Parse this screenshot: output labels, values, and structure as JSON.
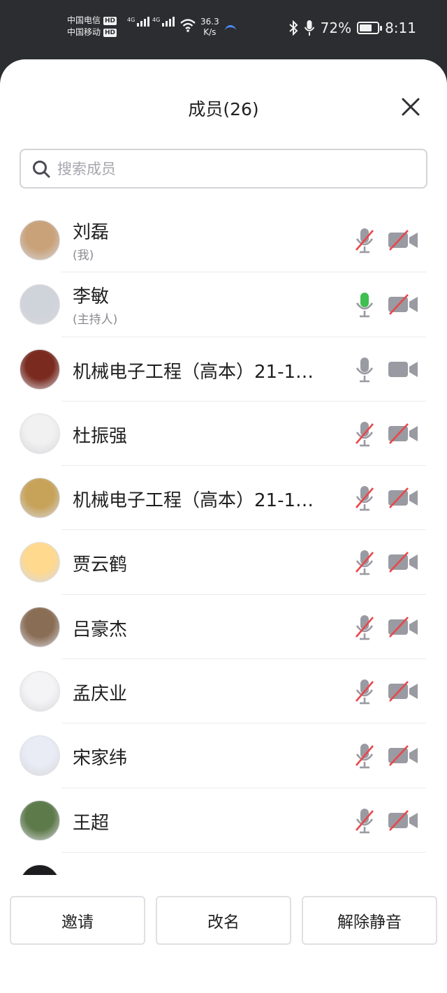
{
  "status_bar": {
    "carrier_1": "中国电信",
    "carrier_2": "中国移动",
    "hd_badge": "HD",
    "network_1": "4G",
    "network_2": "4G",
    "speed_value": "36.3",
    "speed_unit": "K/s",
    "battery_percent": "72%",
    "battery_level": 0.72,
    "time": "8:11"
  },
  "panel": {
    "title": "成员(26)",
    "search_placeholder": "搜索成员"
  },
  "members": [
    {
      "name": "刘磊",
      "role": "(我)",
      "mic": "muted",
      "camera": "off"
    },
    {
      "name": "李敏",
      "role": "(主持人)",
      "mic": "speaking",
      "camera": "off"
    },
    {
      "name": "机械电子工程（高本）21-1…",
      "role": "",
      "mic": "on",
      "camera": "on"
    },
    {
      "name": "杜振强",
      "role": "",
      "mic": "muted",
      "camera": "off"
    },
    {
      "name": "机械电子工程（高本）21-1…",
      "role": "",
      "mic": "muted",
      "camera": "off"
    },
    {
      "name": "贾云鹤",
      "role": "",
      "mic": "muted",
      "camera": "off"
    },
    {
      "name": "吕豪杰",
      "role": "",
      "mic": "muted",
      "camera": "off"
    },
    {
      "name": "孟庆业",
      "role": "",
      "mic": "muted",
      "camera": "off"
    },
    {
      "name": "宋家纬",
      "role": "",
      "mic": "muted",
      "camera": "off"
    },
    {
      "name": "王超",
      "role": "",
      "mic": "muted",
      "camera": "off"
    }
  ],
  "actions": {
    "invite": "邀请",
    "rename": "改名",
    "unmute": "解除静音"
  },
  "colors": {
    "muted_slash": "#e8474b",
    "speaking": "#3fbf4f",
    "icon_gray": "#9a9aa2"
  }
}
